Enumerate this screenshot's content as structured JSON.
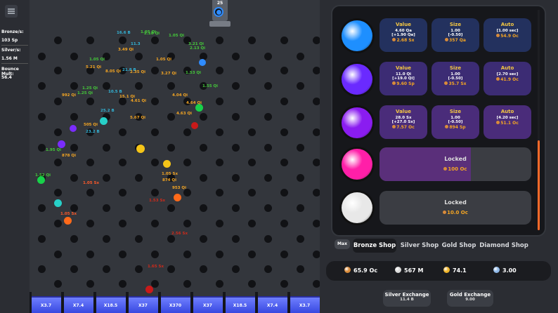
{
  "stats": {
    "bronze_label": "Bronze/s:",
    "bronze_value": "103 Sp",
    "silver_label": "Silver/s:",
    "silver_value": "1.56 M",
    "bounce_label": "Bounce Mult:",
    "bounce_value": "56.4"
  },
  "cannon": {
    "count": "25"
  },
  "buckets": [
    "X3.7",
    "X7.4",
    "X18.5",
    "X37",
    "X370",
    "X37",
    "X18.5",
    "X7.4",
    "X3.7"
  ],
  "floating_texts": [
    {
      "text": "16.6 B",
      "color": "#33b5d8"
    },
    {
      "text": "1.05 Qi",
      "color": "#45c83a"
    },
    {
      "text": "2.18 Qi",
      "color": "#45c83a"
    },
    {
      "text": "1.05 Qi",
      "color": "#45c83a"
    },
    {
      "text": "3.21 Qi",
      "color": "#45c83a"
    },
    {
      "text": "3.49 Qi",
      "color": "#f5a623"
    },
    {
      "text": "11.3",
      "color": "#33b5d8"
    },
    {
      "text": "2.13 Qi",
      "color": "#45c83a"
    },
    {
      "text": "1.05 Qi",
      "color": "#f5a623"
    },
    {
      "text": "1.05 Qi",
      "color": "#45c83a"
    },
    {
      "text": "5.21 Qi",
      "color": "#f5a623"
    },
    {
      "text": "8.05 Qi",
      "color": "#f5a623"
    },
    {
      "text": "21.8 B",
      "color": "#33b5d8"
    },
    {
      "text": "2.35 Qi",
      "color": "#f5a623"
    },
    {
      "text": "3.27 Qi",
      "color": "#f5a623"
    },
    {
      "text": "1.53 Qi",
      "color": "#45c83a"
    },
    {
      "text": "1.25 Qi",
      "color": "#45c83a"
    },
    {
      "text": "1.25 Qi",
      "color": "#45c83a"
    },
    {
      "text": "10.5 B",
      "color": "#33b5d8"
    },
    {
      "text": "992 Qi",
      "color": "#f5a623"
    },
    {
      "text": "1.55 Qi",
      "color": "#45c83a"
    },
    {
      "text": "4.04 Qi",
      "color": "#f5a623"
    },
    {
      "text": "15.1 Qi",
      "color": "#f5a623"
    },
    {
      "text": "4.61 Qi",
      "color": "#f5a623"
    },
    {
      "text": "4.64 Qi",
      "color": "#f5a623"
    },
    {
      "text": "25.2 B",
      "color": "#33b5d8"
    },
    {
      "text": "5.67 Qi",
      "color": "#f5a623"
    },
    {
      "text": "4.63 Qi",
      "color": "#f5a623"
    },
    {
      "text": "505 Qi",
      "color": "#f5a623"
    },
    {
      "text": "23.2 B",
      "color": "#33b5d8"
    },
    {
      "text": "1.95 Qi",
      "color": "#45c83a"
    },
    {
      "text": "878 Qi",
      "color": "#f5a623"
    },
    {
      "text": "1.05 Sx",
      "color": "#f5a623"
    },
    {
      "text": "874 Qi",
      "color": "#f5a623"
    },
    {
      "text": "1.52 Qi",
      "color": "#45c83a"
    },
    {
      "text": "1.05 Sx",
      "color": "#ff5a2a"
    },
    {
      "text": "953 Qi",
      "color": "#f5a623"
    },
    {
      "text": "1.05 Sx",
      "color": "#ff5a2a"
    },
    {
      "text": "1.53 Sx",
      "color": "#d12a1a"
    },
    {
      "text": "2.56 Sx",
      "color": "#d12a1a"
    },
    {
      "text": "1.65 Sx",
      "color": "#d12a1a"
    }
  ],
  "shop": {
    "rows": [
      {
        "ball_color": "#1e8fff",
        "value": {
          "title": "Value",
          "line1": "4.60 Qa",
          "line2": "[+1.90 Qa]",
          "price": "2.68 Sx"
        },
        "size": {
          "title": "Size",
          "line1": "1.00",
          "line2": "[-0.50]",
          "price": "357 Qa"
        },
        "auto": {
          "title": "Auto",
          "line1": "[1.00 sec]",
          "price": "54.9 Oc"
        },
        "card_bg": "#23315e"
      },
      {
        "ball_color": "#6a2aff",
        "value": {
          "title": "Value",
          "line1": "11.0 Qi",
          "line2": "[+19.0 Qi]",
          "price": "9.60 Sp"
        },
        "size": {
          "title": "Size",
          "line1": "1.00",
          "line2": "[-0.50]",
          "price": "35.7 Sx"
        },
        "auto": {
          "title": "Auto",
          "line1": "[2.70 sec]",
          "price": "41.9 Oc"
        },
        "card_bg": "#3c2c74"
      },
      {
        "ball_color": "#8a1cf0",
        "value": {
          "title": "Value",
          "line1": "28.0 Sx",
          "line2": "[+27.0 Sx]",
          "price": "7.57 Oc"
        },
        "size": {
          "title": "Size",
          "line1": "1.00",
          "line2": "[-0.50]",
          "price": "894 Sp"
        },
        "auto": {
          "title": "Auto",
          "line1": "[4.20 sec]",
          "price": "51.1 Oc"
        },
        "card_bg": "#4a2c7a"
      }
    ],
    "locked": [
      {
        "ball_color": "#ff1fa8",
        "title": "Locked",
        "price": "100 Oc",
        "fill_color": "#5a2f7a",
        "progress": 0.6
      },
      {
        "ball_color": "#e8e8e8",
        "title": "Locked",
        "price": "10.0 Oc",
        "fill_color": "#5a2f7a",
        "progress": 0.0
      }
    ]
  },
  "tabs": {
    "max": "Max",
    "items": [
      "Bronze Shop",
      "Silver Shop",
      "Gold Shop",
      "Diamond Shop"
    ],
    "active": 0
  },
  "currencies": [
    {
      "value": "65.9 Oc",
      "color": "#d98b3a"
    },
    {
      "value": "567 M",
      "color": "#d9d9d9"
    },
    {
      "value": "74.1",
      "color": "#f0b429"
    },
    {
      "value": "3.00",
      "color": "#8fb8e8"
    }
  ],
  "exchanges": [
    {
      "title": "Silver Exchange",
      "value": "11.4 B"
    },
    {
      "title": "Gold Exchange",
      "value": "9.00"
    }
  ]
}
